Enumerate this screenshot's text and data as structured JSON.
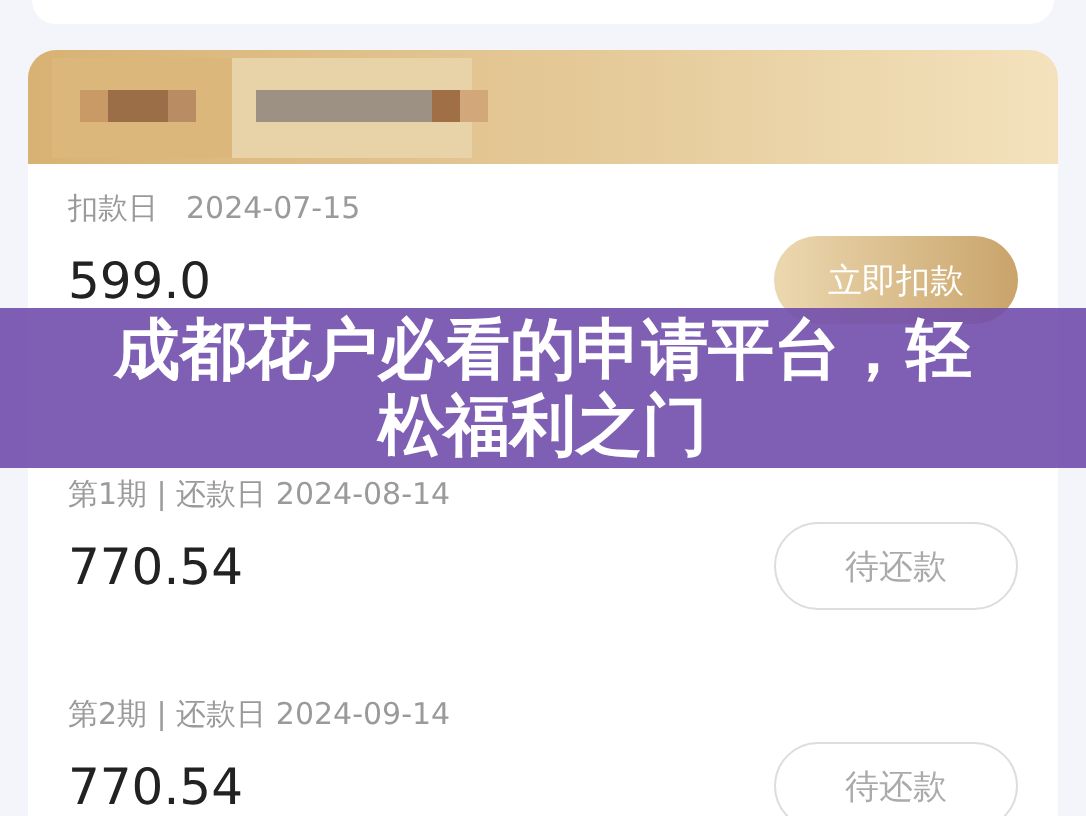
{
  "payments": [
    {
      "label": "扣款日",
      "date": "2024-07-15",
      "amount": "599.0",
      "button": "立即扣款",
      "primary": true
    },
    {
      "label": "第1期 | 还款日 2024-08-14",
      "amount": "770.54",
      "button": "待还款",
      "primary": false
    },
    {
      "label": "第2期 | 还款日 2024-09-14",
      "amount": "770.54",
      "button": "待还款",
      "primary": false
    }
  ],
  "overlay_title": "成都花户必看的申请平台，轻松福利之门"
}
